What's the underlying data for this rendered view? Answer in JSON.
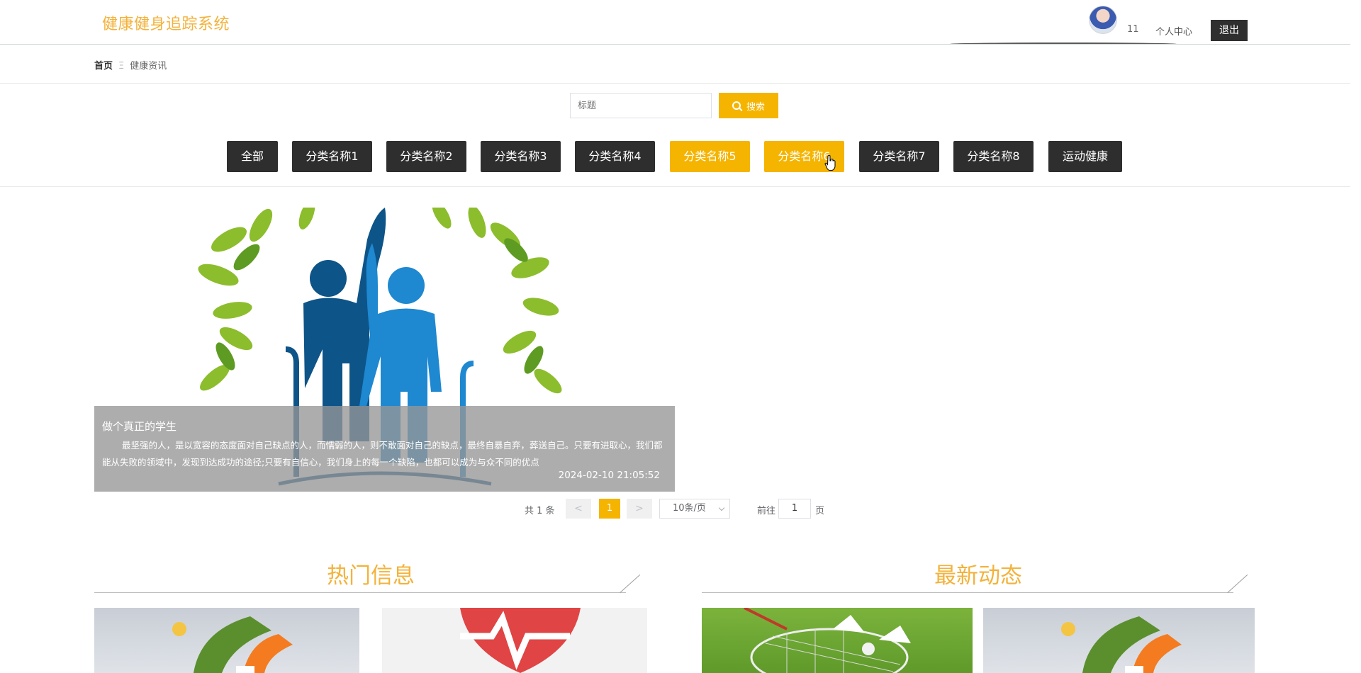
{
  "header": {
    "brand": "健康健身追踪系统",
    "user_name": "11",
    "profile_label": "个人中心",
    "logout_label": "退出"
  },
  "breadcrumb": {
    "home": "首页",
    "separator": "Ξ",
    "current": "健康资讯"
  },
  "search": {
    "placeholder": "标题",
    "button_label": "搜索"
  },
  "categories": [
    {
      "label": "全部",
      "active": false
    },
    {
      "label": "分类名称1",
      "active": false
    },
    {
      "label": "分类名称2",
      "active": false
    },
    {
      "label": "分类名称3",
      "active": false
    },
    {
      "label": "分类名称4",
      "active": false
    },
    {
      "label": "分类名称5",
      "active": true
    },
    {
      "label": "分类名称6",
      "active": true
    },
    {
      "label": "分类名称7",
      "active": false
    },
    {
      "label": "分类名称8",
      "active": false
    },
    {
      "label": "运动健康",
      "active": false
    }
  ],
  "feature": {
    "title": "做个真正的学生",
    "description": "最坚强的人，是以宽容的态度面对自己缺点的人，而懦弱的人，则不敢面对自己的缺点，最终自暴自弃，葬送自己。只要有进取心，我们都能从失败的领域中，发现到达成功的途径;只要有自信心，我们身上的每一个缺陷，也都可以成为与众不同的优点",
    "date": "2024-02-10 21:05:52"
  },
  "pagination": {
    "total": "共 1 条",
    "prev": "<",
    "current": "1",
    "next": ">",
    "page_size": "10条/页",
    "goto_label": "前往",
    "goto_value": "1",
    "page_suffix": "页"
  },
  "sections": {
    "hot": "热门信息",
    "latest": "最新动态"
  },
  "colors": {
    "accent": "#f5b400",
    "title_orange": "#f3b23a",
    "dark_button": "#2e2e2e"
  }
}
